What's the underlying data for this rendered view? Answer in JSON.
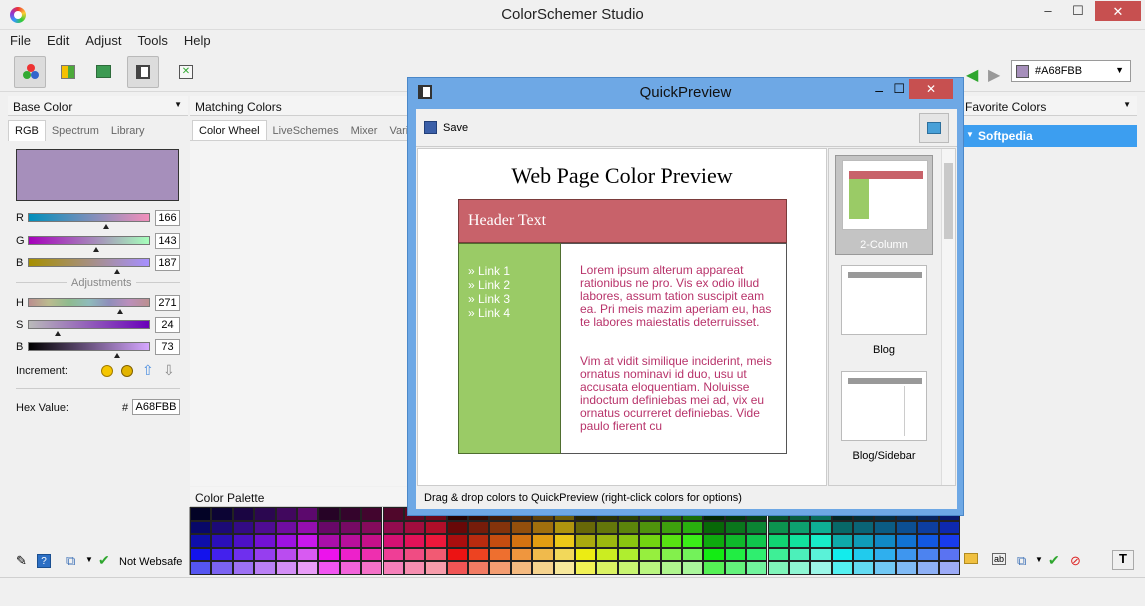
{
  "app": {
    "title": "ColorSchemer Studio",
    "minimize": "–",
    "maximize": "☐",
    "close": "✕"
  },
  "menu": [
    "File",
    "Edit",
    "Adjust",
    "Tools",
    "Help"
  ],
  "topbar": {
    "hex_value": "#A68FBB",
    "swatch_color": "#A68FBB",
    "dropdown": "▼"
  },
  "base_color": {
    "header": "Base Color",
    "tabs": [
      "RGB",
      "Spectrum",
      "Library"
    ],
    "swatch": "#A68FBB",
    "rows": [
      {
        "label": "R",
        "value": "166"
      },
      {
        "label": "G",
        "value": "143"
      },
      {
        "label": "B",
        "value": "187"
      },
      {
        "label": "H",
        "value": "271"
      },
      {
        "label": "S",
        "value": "24"
      },
      {
        "label": "B",
        "value": "73"
      }
    ],
    "adjustments_label": "Adjustments",
    "increment_label": "Increment:",
    "hex_label": "Hex Value:",
    "hash": "#",
    "hex": "A68FBB"
  },
  "matching": {
    "header": "Matching Colors",
    "tabs": [
      "Color Wheel",
      "LiveSchemes",
      "Mixer",
      "Varia"
    ]
  },
  "palette": {
    "header": "Color Palette"
  },
  "bottom_left": {
    "websafe": "Not Websafe"
  },
  "favorites": {
    "header": "Favorite Colors",
    "item": "Softpedia"
  },
  "quickpreview": {
    "title": "QuickPreview",
    "save": "Save",
    "page_title": "Web Page Color Preview",
    "header_text": "Header Text",
    "links": [
      "» Link 1",
      "» Link 2",
      "» Link 3",
      "» Link 4"
    ],
    "para1": "Lorem ipsum alterum appareat rationibus ne pro. Vis ex odio illud labores, assum tation suscipit eam ea. Pri meis mazim aperiam eu, has te labores maiestatis deterruisset.",
    "para2": "Vim at vidit similique inciderint, meis ornatus nominavi id duo, usu ut accusata eloquentiam. Noluisse indoctum definiebas mei ad, vix eu ornatus ocurreret definiebas. Vide paulo fierent cu",
    "templates": [
      "2-Column",
      "Blog",
      "Blog/Sidebar"
    ],
    "status": "Drag & drop colors to QuickPreview (right-click colors for options)",
    "colors": {
      "header": "#c8626a",
      "sidebar": "#9acb66",
      "text": "#b8336a"
    }
  }
}
